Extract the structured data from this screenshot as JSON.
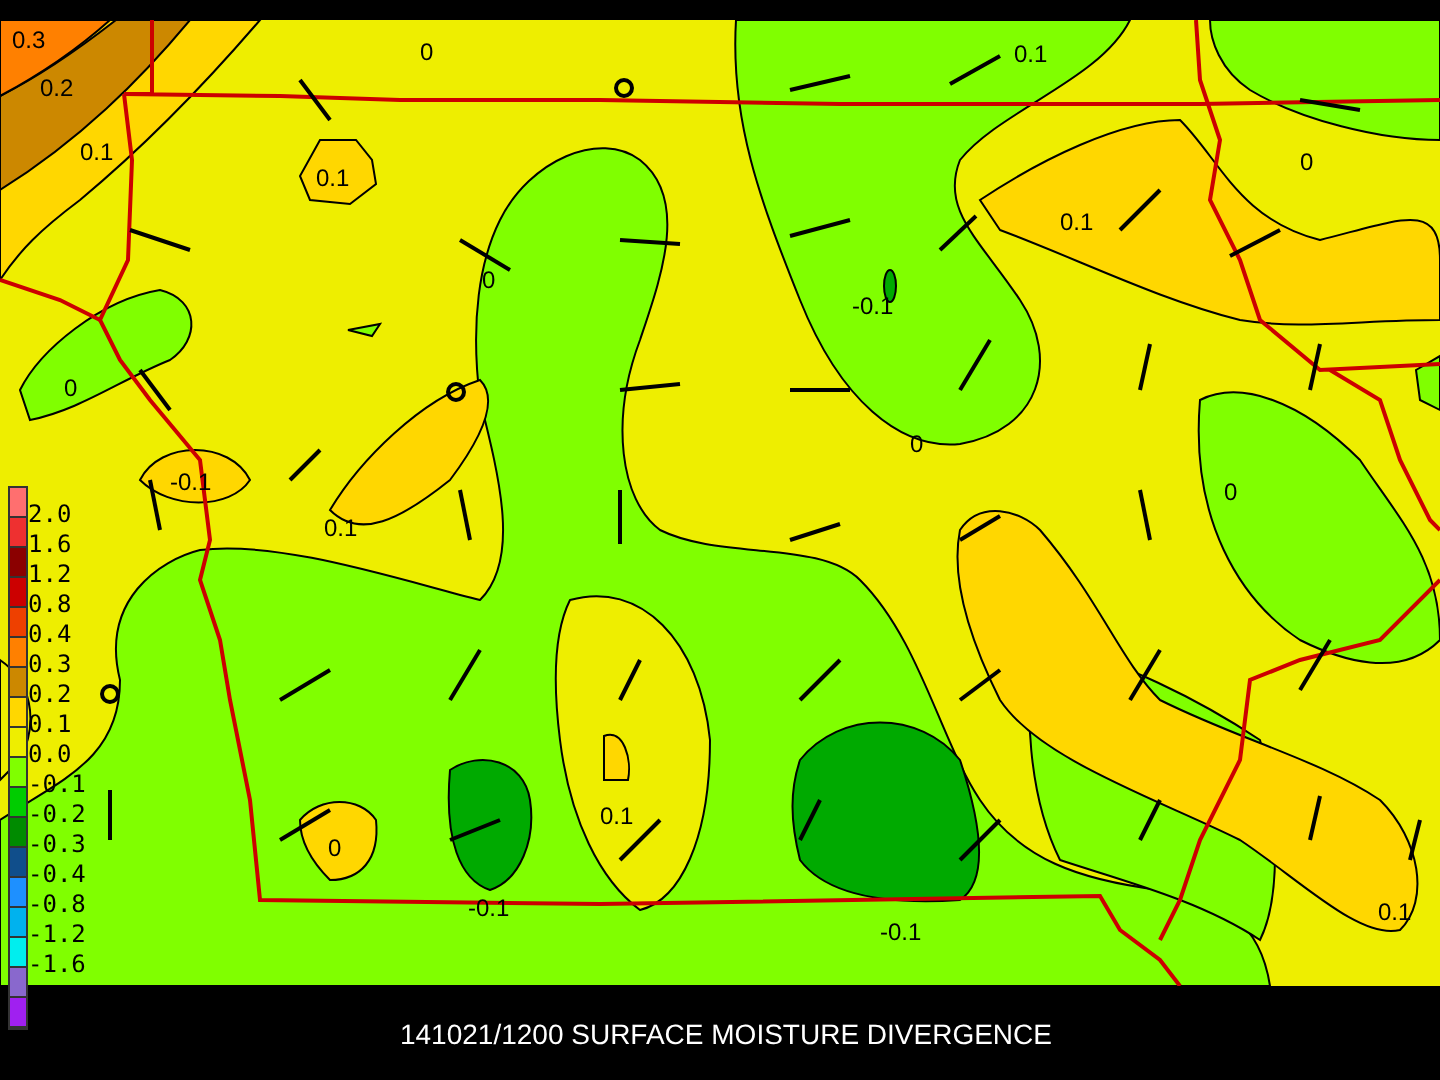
{
  "map": {
    "contour_labels": [
      "0.3",
      "0.2",
      "0.1",
      "0",
      "0.1",
      "0",
      "0.1",
      "0.1",
      "0",
      "-0.1",
      "0",
      "0",
      "-0.1",
      "0.1",
      "0",
      "0.1",
      "0",
      "-0.1",
      "-0.1",
      "0.1"
    ]
  },
  "legend": {
    "swatches": [
      {
        "color": "#ff6f6f"
      },
      {
        "color": "#ee3030"
      },
      {
        "color": "#8b0000"
      },
      {
        "color": "#cc0000"
      },
      {
        "color": "#ee4000"
      },
      {
        "color": "#ff8000"
      },
      {
        "color": "#cc8800"
      },
      {
        "color": "#ffd700"
      },
      {
        "color": "#eeee00"
      },
      {
        "color": "#80ff00"
      },
      {
        "color": "#00cc00"
      },
      {
        "color": "#008b00"
      },
      {
        "color": "#104e8b"
      },
      {
        "color": "#1e90ff"
      },
      {
        "color": "#00b2ee"
      },
      {
        "color": "#00eeee"
      },
      {
        "color": "#8968cd"
      },
      {
        "color": "#a020f0"
      }
    ],
    "labels": [
      "2.0",
      "1.6",
      "1.2",
      "0.8",
      "0.4",
      "0.3",
      "0.2",
      "0.1",
      "0.0",
      "-0.1",
      "-0.2",
      "-0.3",
      "-0.4",
      "-0.8",
      "-1.2",
      "-1.6"
    ]
  },
  "caption": "141021/1200 SURFACE MOISTURE DIVERGENCE"
}
